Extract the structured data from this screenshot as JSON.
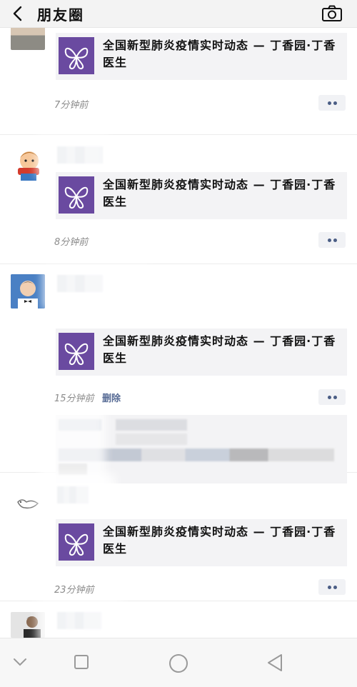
{
  "header": {
    "title": "朋友圈"
  },
  "posts": [
    {
      "link_title": "全国新型肺炎疫情实时动态 — 丁香园·丁香医生",
      "time": "7分钟前"
    },
    {
      "link_title": "全国新型肺炎疫情实时动态 — 丁香园·丁香医生",
      "time": "8分钟前"
    },
    {
      "link_title": "全国新型肺炎疫情实时动态 — 丁香园·丁香医生",
      "time": "15分钟前",
      "delete_label": "删除"
    },
    {
      "link_title": "全国新型肺炎疫情实时动态 — 丁香园·丁香医生",
      "time": "23分钟前"
    }
  ],
  "icons": {
    "back": "chevron-left-icon",
    "camera": "camera-icon",
    "thumb": "purple-butterfly-logo",
    "more": "more-dots-icon",
    "nav_back": "triangle-back-icon",
    "nav_home": "circle-home-icon",
    "nav_recent": "square-recent-icon",
    "nav_hide": "chevron-down-icon"
  },
  "colors": {
    "accent": "#576b95",
    "thumb": "#6a4aa0"
  }
}
